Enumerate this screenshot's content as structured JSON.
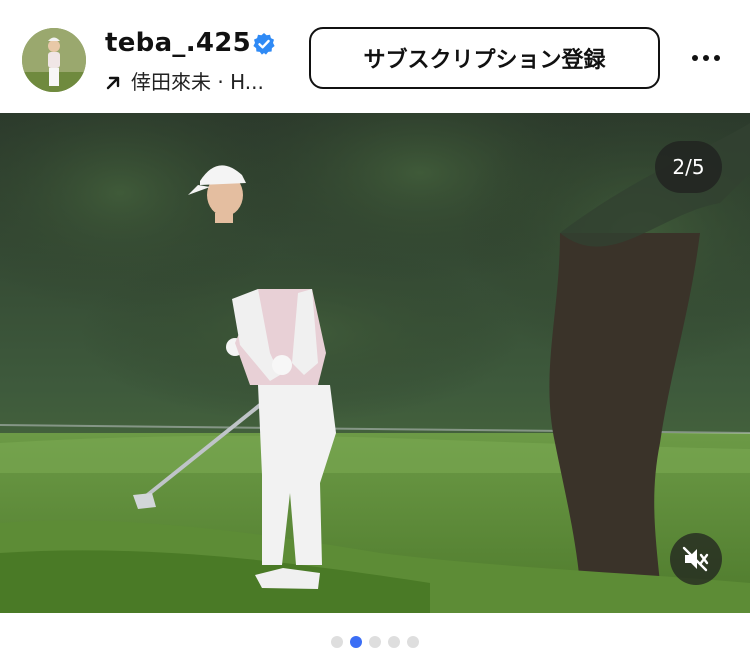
{
  "header": {
    "username": "teba_.425",
    "subline": "倖田來未 · H...",
    "subscribe_label": "サブスクリプション登録"
  },
  "post": {
    "counter": "2/5",
    "current_index": 2,
    "total": 5
  },
  "icons": [
    "avatar",
    "verified-badge-icon",
    "arrow-up-right-icon",
    "more-icon",
    "mute-icon"
  ],
  "colors": {
    "verified": "#2f8af5",
    "active_dot": "#3b6ef5",
    "inactive_dot": "#dedede"
  }
}
